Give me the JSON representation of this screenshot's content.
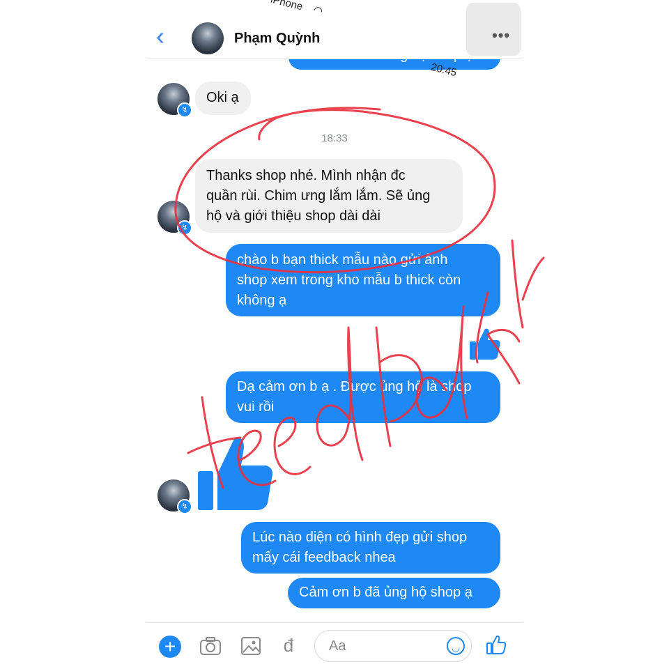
{
  "status_bar": {
    "carrier": "iPhone",
    "time": "20:45",
    "wifi_icon": "wifi-icon"
  },
  "header": {
    "contact_name": "Phạm Quỳnh",
    "back_icon": "chevron-left-icon",
    "more_icon": "ellipsis-icon"
  },
  "messages": {
    "peek_text": "Cảm ơn b đã ủng hộ shop ạ",
    "msg1": "Oki ạ",
    "timestamp": "18:33",
    "msg2_lines": [
      "Thanks shop nhé. Mình nhận đc",
      "quần rùi. Chim ưng lắm lắm. Sẽ ủng",
      "hộ và giới thiệu shop dài dài"
    ],
    "msg3_lines": [
      "chào b  bạn thick mẫu nào gửi ảnh",
      "shop xem trong kho mẫu b thick còn",
      "không ạ"
    ],
    "msg4_lines": [
      "Dạ cảm ơn b ạ . Được ủng hộ là shop vui rồi",
      "ạ"
    ],
    "msg5_lines": [
      "Lúc nào diện có hình đẹp gửi shop",
      "mấy cái feedback nhea"
    ],
    "msg6": "Cảm ơn b đã ủng hộ shop ạ"
  },
  "composer": {
    "plus_label": "+",
    "placeholder": "Aa",
    "icons": [
      "plus-icon",
      "camera-icon",
      "image-icon",
      "dong-currency-icon",
      "emoji-icon",
      "thumbs-up-icon"
    ],
    "currency_symbol": "đ"
  },
  "colors": {
    "accent": "#1e88f5",
    "incoming_bubble": "#f0f0f0",
    "annotation": "#e8313f"
  },
  "annotation": {
    "handwritten_word": "feedback"
  }
}
